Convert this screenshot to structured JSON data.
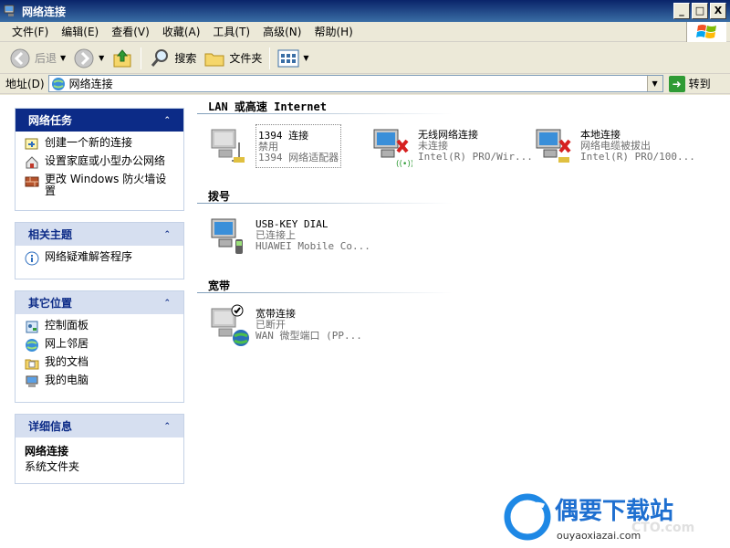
{
  "window": {
    "title": "网络连接",
    "controls": [
      "_",
      "□",
      "X"
    ]
  },
  "menu": [
    "文件(F)",
    "编辑(E)",
    "查看(V)",
    "收藏(A)",
    "工具(T)",
    "高级(N)",
    "帮助(H)"
  ],
  "toolbar": {
    "back": "后退",
    "search": "搜索",
    "folders": "文件夹"
  },
  "address": {
    "label": "地址(D)",
    "value": "网络连接",
    "go": "转到"
  },
  "task_panels": {
    "network_tasks": {
      "title": "网络任务",
      "items": [
        "创建一个新的连接",
        "设置家庭或小型办公网络",
        "更改 Windows 防火墙设置"
      ]
    },
    "related": {
      "title": "相关主题",
      "items": [
        "网络疑难解答程序"
      ]
    },
    "other_places": {
      "title": "其它位置",
      "items": [
        "控制面板",
        "网上邻居",
        "我的文档",
        "我的电脑"
      ]
    },
    "details": {
      "title": "详细信息",
      "name": "网络连接",
      "type": "系统文件夹"
    }
  },
  "groups": {
    "lan": {
      "title": "LAN 或高速 Internet",
      "connections": [
        {
          "name": "1394 连接",
          "status": "禁用",
          "device": "1394 网络适配器"
        },
        {
          "name": "无线网络连接",
          "status": "未连接",
          "device": "Intel(R) PRO/Wir..."
        },
        {
          "name": "本地连接",
          "status": "网络电缆被拔出",
          "device": "Intel(R) PRO/100..."
        }
      ]
    },
    "dialup": {
      "title": "拨号",
      "connections": [
        {
          "name": "USB-KEY DIAL",
          "status": "已连接上",
          "device": "HUAWEI Mobile Co..."
        }
      ]
    },
    "broadband": {
      "title": "宽带",
      "connections": [
        {
          "name": "宽带连接",
          "status": "已断开",
          "device": "WAN 微型端口 (PP..."
        }
      ]
    }
  },
  "watermark": {
    "brand": "偶要下载站",
    "url": "ouyaoxiazai.com",
    "overlay": "CTO.com"
  },
  "colors": {
    "titlebar": "#0a246a",
    "panel_header": "#0c2b87",
    "panel_light": "#d6dff0"
  }
}
